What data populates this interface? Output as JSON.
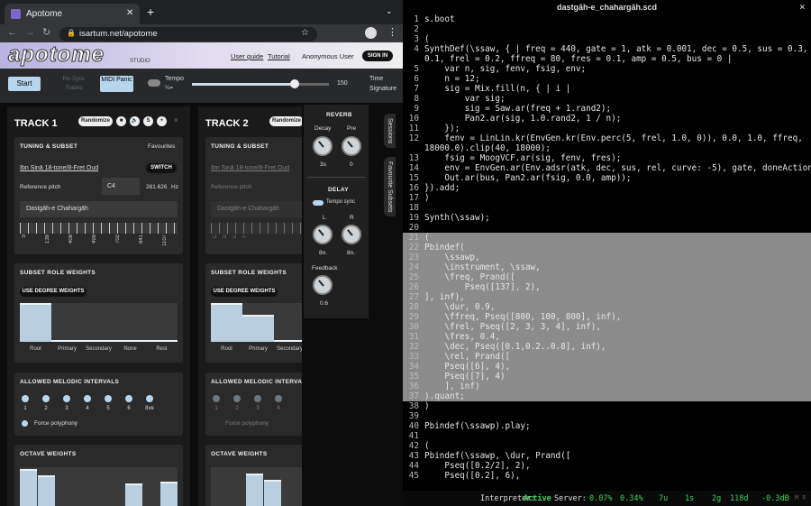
{
  "browser": {
    "tab_title": "Apotome",
    "url": "isartum.net/apotome"
  },
  "app": {
    "logo": "apotome",
    "logo_sub": "STUDIO",
    "links": [
      "User guide",
      "Tutorial"
    ],
    "user": "Anonymous User",
    "signin": "SIGN IN"
  },
  "controls": {
    "start": "Start",
    "resync": "Re-Sync Tracks",
    "midi": "MIDI Panic",
    "tempo_label": "Tempo",
    "tempo_sub": "¼=",
    "tempo_value": "150",
    "tempo_fraction": 0.75,
    "time_sig": "Time Signature"
  },
  "tracks": [
    {
      "title": "TRACK 1",
      "randomize": "Randomize",
      "icons": [
        "S"
      ],
      "tuning_title": "TUNING & SUBSET",
      "favourites": "Favourites",
      "tuning_name": "Ibn Sinā 18-tone/8-Fret Oud",
      "switch": "SWITCH",
      "ref_label": "Reference pitch",
      "ref_note": "C4",
      "ref_hz": "261.626",
      "hz": "Hz",
      "preset": "Dastgāh-e Chahargāh",
      "ticks": [
        "0",
        "139",
        "408",
        "498",
        "702",
        "841",
        "1107"
      ]
    },
    {
      "title": "TRACK 2",
      "randomize": "Randomize",
      "tuning_title": "TUNING & SUBSET",
      "tuning_name": "Ibn Sinā 18-tone/8-Fret Oud",
      "ref_label": "Reference pitch",
      "preset": "Dastgāh-e Chahargāh",
      "ticks": [
        "C",
        "D",
        "E",
        "F"
      ]
    }
  ],
  "weights": {
    "title": "SUBSET ROLE WEIGHTS",
    "button": "USE DEGREE WEIGHTS",
    "labels": [
      "Root",
      "Primary",
      "Secondary",
      "None",
      "Rest"
    ],
    "values_t1": [
      1,
      0,
      0,
      0,
      0
    ],
    "values_t2": [
      1,
      0.7,
      0,
      0,
      0
    ]
  },
  "intervals": {
    "title": "ALLOWED MELODIC INTERVALS",
    "labels": [
      "1",
      "2",
      "3",
      "4",
      "5",
      "6",
      "8ve"
    ],
    "labels_t2": [
      "1",
      "2",
      "3",
      "4"
    ],
    "poly": "Force polyphony"
  },
  "octave": {
    "title": "OCTAVE WEIGHTS"
  },
  "fx": {
    "reverb": "REVERB",
    "decay": "Decay",
    "pre": "Pre",
    "decay_v": "3s",
    "pre_v": "0",
    "delay": "DELAY",
    "sync": "Tempo sync",
    "l": "L",
    "r": "R",
    "l_v": "8n.",
    "r_v": "8n.",
    "feedback": "Feedback",
    "fb_v": "0.6"
  },
  "side": [
    "Sessions",
    "Favourite Subsets"
  ],
  "editor": {
    "title": "dastgāh-e_chahargāh.scd",
    "close": "×",
    "lines": [
      "s.boot",
      "",
      "(",
      "SynthDef(\\ssaw, { | freq = 440, gate = 1, atk = 0.001, dec = 0.5, sus = 0.3, rel =",
      "0.1, frel = 0.2, ffreq = 80, fres = 0.1, amp = 0.5, bus = 0 |",
      "    var n, sig, fenv, fsig, env;",
      "    n = 12;",
      "    sig = Mix.fill(n, { | i |",
      "        var sig;",
      "        sig = Saw.ar(freq + 1.rand2);",
      "        Pan2.ar(sig, 1.0.rand2, 1 / n);",
      "    });",
      "    fenv = LinLin.kr(EnvGen.kr(Env.perc(5, frel, 1.0, 0)), 0.0, 1.0, ffreq,",
      "18000.0).clip(40, 18000);",
      "    fsig = MoogVCF.ar(sig, fenv, fres);",
      "    env = EnvGen.ar(Env.adsr(atk, dec, sus, rel, curve: -5), gate, doneAction: 2);",
      "    Out.ar(bus, Pan2.ar(fsig, 0.0, amp));",
      "}).add;",
      ")",
      "",
      "Synth(\\ssaw);",
      "",
      "(",
      "Pbindef(",
      "    \\ssawp,",
      "    \\instrument, \\ssaw,",
      "    \\freq, Prand([",
      "        Pseq([137], 2),",
      "], inf),",
      "    \\dur, 0.9,",
      "    \\ffreq, Pseq([800, 100, 800], inf),",
      "    \\frel, Pseq([2, 3, 3, 4], inf),",
      "    \\fres, 0.4,",
      "    \\dec, Pseq([0.1,0.2..0.8], inf),",
      "    \\rel, Prand([",
      "    Pseq([6], 4),",
      "    Pseq([7], 4)",
      "    ], inf)",
      ").quant;",
      ")",
      "",
      "Pbindef(\\ssawp).play;",
      "",
      "(",
      "Pbindef(\\ssawp, \\dur, Prand([",
      "    Pseq([0.2/2], 2),",
      "    Pseq([0.2], 6),"
    ],
    "numbers": [
      "1",
      "2",
      "3",
      "4",
      "",
      "5",
      "6",
      "7",
      "8",
      "9",
      "10",
      "11",
      "12",
      "",
      "13",
      "14",
      "15",
      "16",
      "17",
      "18",
      "19",
      "20",
      "21",
      "22",
      "23",
      "24",
      "25",
      "26",
      "27",
      "28",
      "29",
      "30",
      "31",
      "32",
      "33",
      "34",
      "35",
      "36",
      "37",
      "38",
      "39",
      "40",
      "41",
      "42",
      "43",
      "44",
      "45"
    ]
  },
  "status": {
    "interp": "Interpreter:",
    "active": "Active",
    "server": "Server:",
    "vals": [
      "0.07%",
      "0.34%",
      "7u",
      "1s",
      "2g",
      "118d",
      "-0.3dB"
    ],
    "mr": "M R"
  }
}
